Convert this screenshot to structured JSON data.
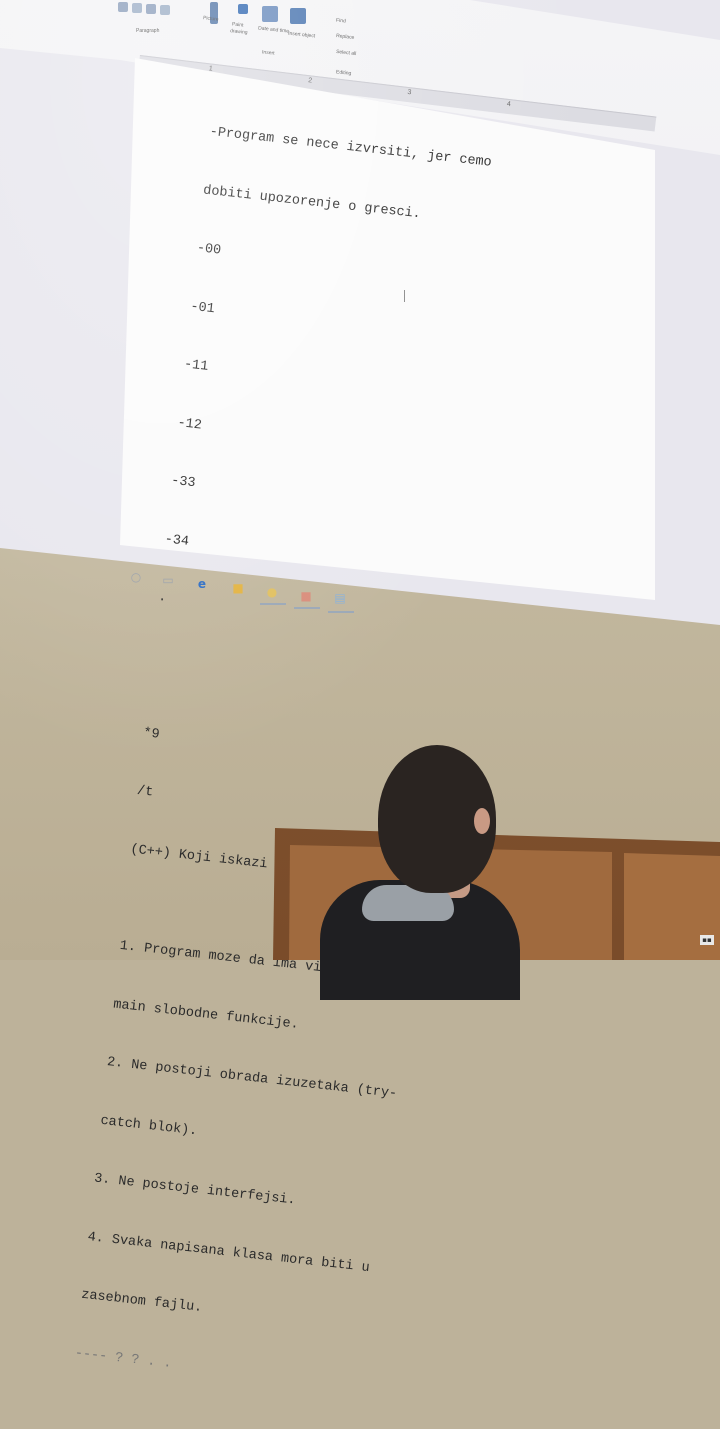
{
  "ribbon": {
    "paragraph_label": "Paragraph",
    "picture_label": "Picture",
    "paint_label": "Paint",
    "drawing_label": "drawing",
    "date_time_label": "Date and time",
    "insert_object_label": "Insert object",
    "insert_group_label": "Insert",
    "find_label": "Find",
    "replace_label": "Replace",
    "select_all_label": "Select all",
    "editing_group_label": "Editing"
  },
  "ruler": {
    "marks": [
      "1",
      "2",
      "3",
      "4"
    ]
  },
  "document": {
    "lines": [
      "-Program se nece izvrsiti, jer cemo",
      "dobiti upozorenje o gresci.",
      "-00",
      "-01",
      "-11",
      "-12",
      "-33",
      "-34",
      ".",
      "",
      "",
      "*9",
      "/t",
      "(C++) Koji iskazi su taÄ ni:",
      "",
      "1. Program moze da ima vise od jedne",
      "main slobodne funkcije.",
      "2. Ne postoji obrada izuzetaka (try-",
      "catch blok).",
      "3. Ne postoje interfejsi.",
      "4. Svaka napisana klasa mora biti u",
      "zasebnom fajlu."
    ],
    "partial_line": "---- ? ? . ."
  },
  "taskbar": {
    "icons": [
      "search-icon",
      "task-view-icon",
      "edge-icon",
      "file-explorer-icon",
      "chrome-icon",
      "app-icon",
      "notepad-icon"
    ]
  },
  "colors": {
    "page_background": "#fbfbfb",
    "document_text": "#2b2b2b",
    "wall": "#c6bca3",
    "cabinet": "#8a5a35"
  }
}
